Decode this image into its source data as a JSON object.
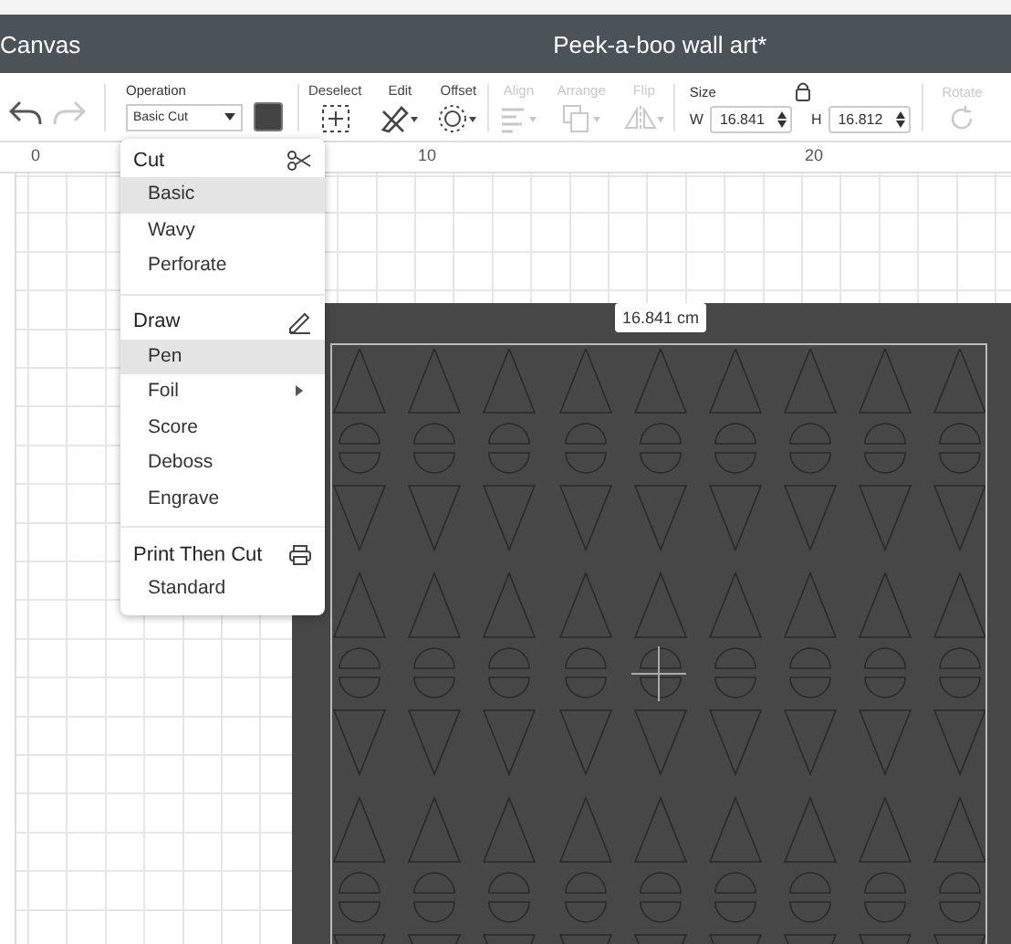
{
  "header": {
    "breadcrumb": "Canvas",
    "title": "Peek-a-boo wall art*"
  },
  "toolbar": {
    "undo": {
      "disabled": false
    },
    "redo": {
      "disabled": true
    },
    "operation": {
      "label": "Operation",
      "value": "Basic Cut"
    },
    "tools": [
      {
        "kind": "deselect",
        "label": "Deselect",
        "disabled": false
      },
      {
        "kind": "edit",
        "label": "Edit",
        "disabled": false
      },
      {
        "kind": "offset",
        "label": "Offset",
        "disabled": false
      },
      {
        "kind": "align",
        "label": "Align",
        "disabled": true
      },
      {
        "kind": "arrange",
        "label": "Arrange",
        "disabled": true
      },
      {
        "kind": "flip",
        "label": "Flip",
        "disabled": true
      }
    ],
    "size": {
      "label": "Size",
      "w_label": "W",
      "w_value": "16.841",
      "h_label": "H",
      "h_value": "16.812",
      "locked": true
    },
    "rotate": {
      "label": "Rotate",
      "disabled": true
    }
  },
  "ruler": [
    "0",
    "10",
    "20"
  ],
  "operation_menu": [
    {
      "title": "Cut",
      "kind": "cut",
      "items": [
        {
          "label": "Basic",
          "selected": true,
          "submenu": false
        },
        {
          "label": "Wavy",
          "selected": false,
          "submenu": false
        },
        {
          "label": "Perforate",
          "selected": false,
          "submenu": false
        }
      ]
    },
    {
      "title": "Draw",
      "kind": "draw",
      "items": [
        {
          "label": "Pen",
          "selected": true,
          "submenu": false
        },
        {
          "label": "Foil",
          "selected": false,
          "submenu": true
        },
        {
          "label": "Score",
          "selected": false,
          "submenu": false
        },
        {
          "label": "Deboss",
          "selected": false,
          "submenu": false
        },
        {
          "label": "Engrave",
          "selected": false,
          "submenu": false
        }
      ]
    },
    {
      "title": "Print Then Cut",
      "kind": "print",
      "items": [
        {
          "label": "Standard",
          "selected": false,
          "submenu": false
        }
      ]
    }
  ],
  "canvas": {
    "dimension_label": "16.841 cm"
  }
}
